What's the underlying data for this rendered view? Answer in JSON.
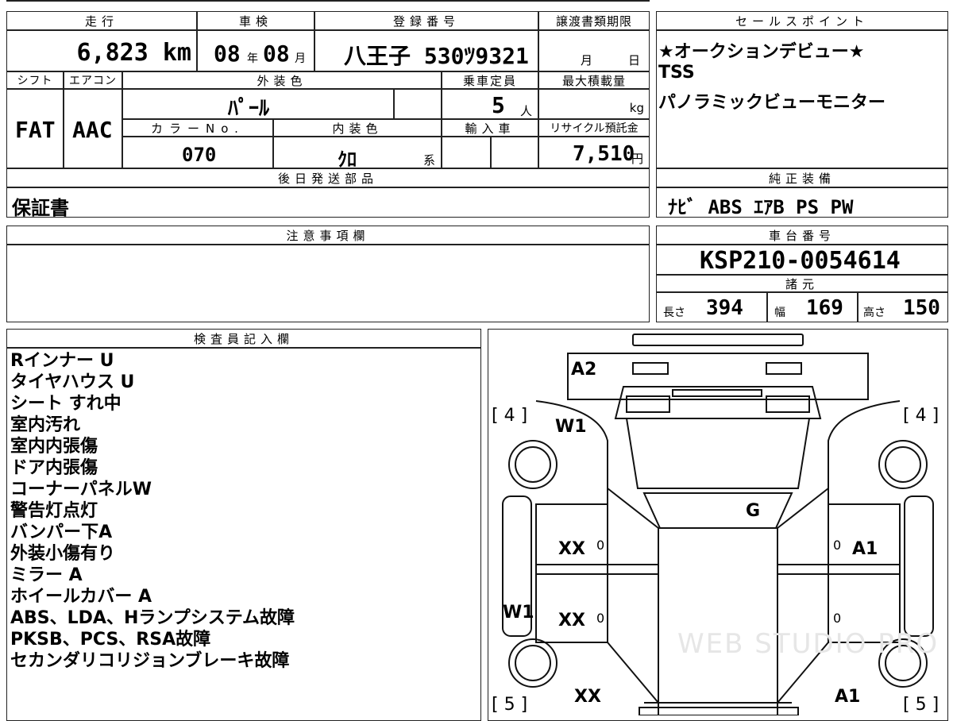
{
  "top_left": {
    "headers": {
      "mileage": "走行",
      "inspection": "車検",
      "registration": "登録番号",
      "transfer_deadline": "譲渡書類期限"
    },
    "mileage": "6,823 km",
    "inspection_year": "08",
    "inspection_year_unit": "年",
    "inspection_month": "08",
    "inspection_month_unit": "月",
    "registration": "八王子 530ﾂ9321",
    "deadline_month_unit": "月",
    "deadline_day_unit": "日",
    "headers2": {
      "shift": "シフト",
      "aircon": "エアコン",
      "exterior_color": "外装色",
      "capacity": "乗車定員",
      "max_load": "最大積載量",
      "color_no": "カラーNo.",
      "interior_color": "内装色",
      "import": "輸入車",
      "recycle": "リサイクル預託金"
    },
    "shift": "FAT",
    "aircon": "AAC",
    "exterior_color": "ﾊﾟｰﾙ",
    "capacity": "5",
    "capacity_unit": "人",
    "max_load_unit": "kg",
    "color_no": "070",
    "interior_color": "ｸﾛ",
    "interior_color_suffix": "系",
    "recycle_fee": "7,510",
    "recycle_unit": "円",
    "later_parts_header": "後日発送部品",
    "later_parts": "保証書"
  },
  "sales_points": {
    "header": "セールスポイント",
    "lines": [
      "★オークションデビュー★",
      "TSS",
      "パノラミックビューモニター"
    ]
  },
  "genuine_equipment": {
    "header": "純正装備",
    "value": "ﾅﾋﾞ ABS ｴｱB PS PW"
  },
  "caution": {
    "header": "注意事項欄"
  },
  "chassis": {
    "header": "車台番号",
    "value": "KSP210-0054614",
    "specs_header": "諸元",
    "length_label": "長さ",
    "length": "394",
    "width_label": "幅",
    "width": "169",
    "height_label": "高さ",
    "height": "150"
  },
  "inspector": {
    "header": "検査員記入欄",
    "notes": [
      "Rインナー U",
      "タイヤハウス U",
      "シート すれ中",
      "室内汚れ",
      "室内内張傷",
      "ドア内張傷",
      "コーナーパネルW",
      "警告灯点灯",
      "バンパー下A",
      "外装小傷有り",
      "ミラー A",
      "ホイールカバー A",
      "ABS、LDA、Hランプシステム故障",
      "PKSB、PCS、RSA故障",
      "セカンダリコリジョンブレーキ故障"
    ]
  },
  "diagram": {
    "tire_front_left": "[ 4 ]",
    "tire_front_right": "[ 4 ]",
    "tire_rear_left": "[ 5 ]",
    "tire_rear_right": "[ 5 ]",
    "mark_a2": "A2",
    "mark_w1_top": "W1",
    "mark_g": "G",
    "mark_xx_1": "XX",
    "mark_xx_2": "XX",
    "mark_xx_3": "XX",
    "mark_a1_1": "A1",
    "mark_a1_2": "A1",
    "mark_w1_side": "W1",
    "mark_zero": "0",
    "watermark": "WEB STUDIO PRO"
  }
}
